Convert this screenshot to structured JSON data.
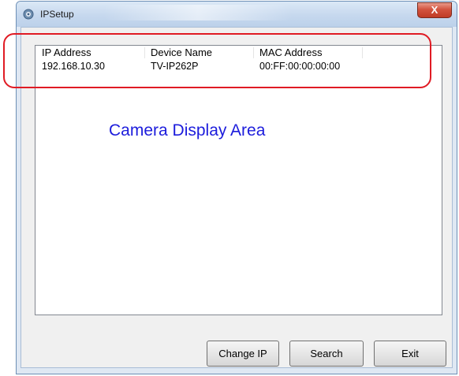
{
  "window": {
    "title": "IPSetup",
    "close_symbol": "X"
  },
  "table": {
    "headers": [
      "IP Address",
      "Device Name",
      "MAC Address"
    ],
    "rows": [
      [
        "192.168.10.30",
        "TV-IP262P",
        "00:FF:00:00:00:00"
      ]
    ]
  },
  "annotation": {
    "label": "Camera Display Area",
    "highlight_color": "#e01b24",
    "label_color": "#1c1cdc"
  },
  "buttons": {
    "change_ip": "Change IP",
    "search": "Search",
    "exit": "Exit"
  },
  "icons": {
    "app": "ipsetup-app-icon",
    "close": "close-icon"
  }
}
